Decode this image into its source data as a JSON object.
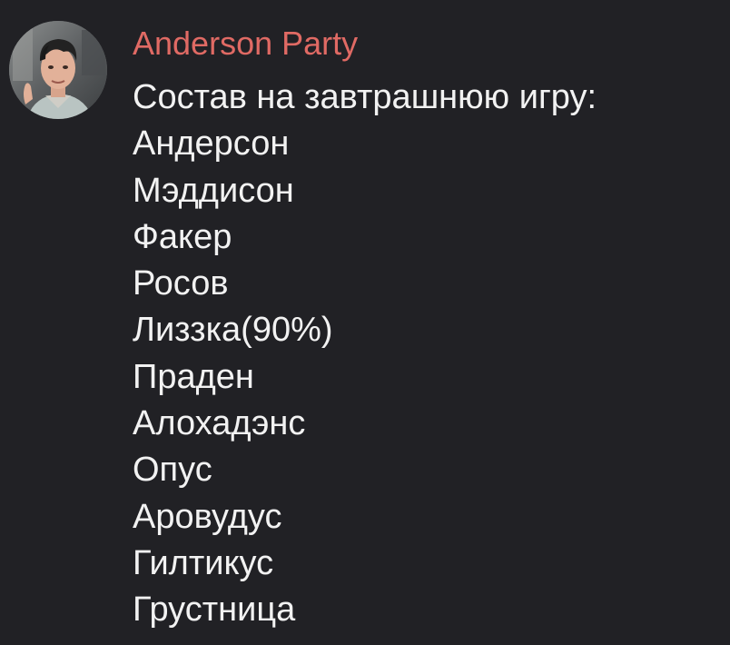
{
  "message": {
    "sender_name": "Anderson Party",
    "intro": "Состав на завтрашнюю игру:",
    "roster": [
      "Андерсон",
      "Мэддисон",
      "Факер",
      "Росов",
      "Лиззка(90%)",
      "Праден",
      "Алохадэнс",
      "Опус",
      "Аровудус",
      "Гилтикус",
      "Грустница"
    ]
  },
  "colors": {
    "background": "#212125",
    "sender": "#e06a64",
    "text": "#f2f2f2"
  },
  "icons": {
    "avatar": "user-photo-avatar"
  }
}
